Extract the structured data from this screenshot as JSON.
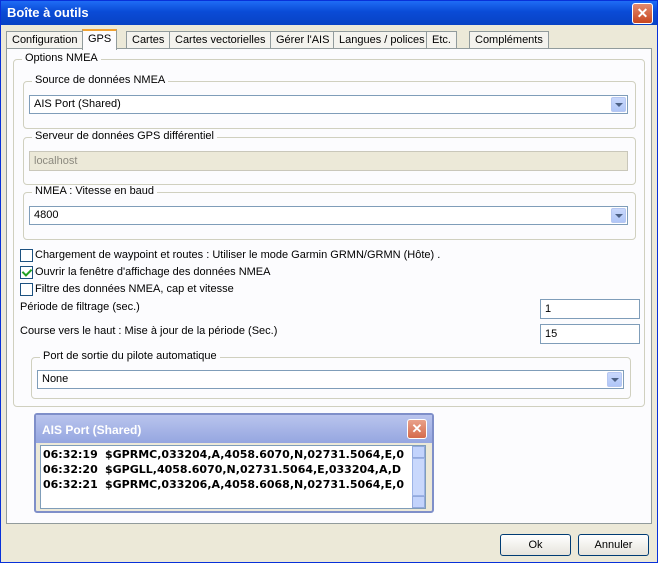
{
  "window": {
    "title": "Boîte à outils",
    "close_glyph": "✕"
  },
  "tabs": [
    "Configuration",
    "GPS",
    "Cartes",
    "Cartes vectorielles",
    "Gérer l'AIS",
    "Langues / polices",
    "Etc.",
    "Compléments"
  ],
  "active_tab": "GPS",
  "nmea_options": {
    "legend": "Options NMEA",
    "source": {
      "legend": "Source de données NMEA",
      "value": "AIS Port (Shared)"
    },
    "dgps_server": {
      "legend": "Serveur de données GPS différentiel",
      "value": "localhost"
    },
    "baud": {
      "legend": "NMEA : Vitesse en baud",
      "value": "4800"
    },
    "checkboxes": [
      {
        "label": "Chargement de waypoint et routes : Utiliser le mode Garmin GRMN/GRMN (Hôte) .",
        "checked": false
      },
      {
        "label": "Ouvrir la fenêtre d'affichage des données NMEA",
        "checked": true
      },
      {
        "label": "Filtre des données NMEA, cap et vitesse",
        "checked": false
      }
    ],
    "filter_period": {
      "label": "Période de filtrage (sec.)",
      "value": "1"
    },
    "course_up": {
      "label": "Course vers le haut : Mise à jour de la période (Sec.)",
      "value": "15"
    },
    "autopilot": {
      "legend": "Port de sortie du pilote automatique",
      "value": "None"
    }
  },
  "console": {
    "title": "AIS Port (Shared)",
    "close_glyph": "✕",
    "lines": [
      {
        "time": "06:32:19",
        "text": "$GPRMC,033204,A,4058.6070,N,02731.5064,E,0"
      },
      {
        "time": "06:32:20",
        "text": "$GPGLL,4058.6070,N,02731.5064,E,033204,A,D"
      },
      {
        "time": "06:32:21",
        "text": "$GPRMC,033206,A,4058.6068,N,02731.5064,E,0"
      }
    ]
  },
  "buttons": {
    "ok": "Ok",
    "cancel": "Annuler"
  }
}
